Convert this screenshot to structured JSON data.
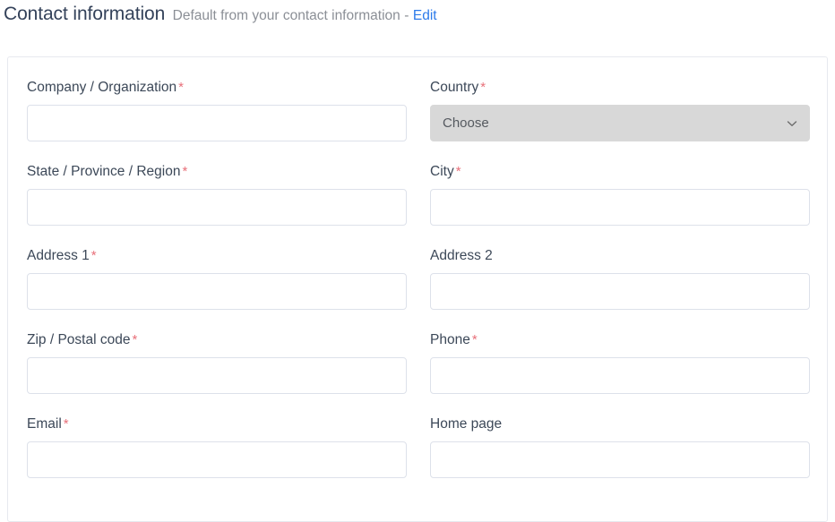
{
  "header": {
    "title": "Contact information",
    "subtitle": "Default from your contact information",
    "separator": "-",
    "edit_label": "Edit"
  },
  "colors": {
    "page_background": "#ffffff",
    "card_border": "#e7e9ef",
    "label_text": "#3c4858",
    "subtitle_text": "#8b8f96",
    "link_blue": "#2d7bea",
    "required_asterisk": "#e8707a",
    "input_border": "#dde1ea",
    "select_background": "#d8d8d8"
  },
  "form": {
    "required_marker": "*",
    "fields": [
      {
        "name": "company",
        "label": "Company / Organization",
        "required": true,
        "type": "text",
        "value": "",
        "placeholder": ""
      },
      {
        "name": "country",
        "label": "Country",
        "required": true,
        "type": "select",
        "value": "Choose",
        "icon": "chevron-down-icon"
      },
      {
        "name": "state",
        "label": "State / Province / Region",
        "required": true,
        "type": "text",
        "value": "",
        "placeholder": ""
      },
      {
        "name": "city",
        "label": "City",
        "required": true,
        "type": "text",
        "value": "",
        "placeholder": ""
      },
      {
        "name": "address1",
        "label": "Address 1",
        "required": true,
        "type": "text",
        "value": "",
        "placeholder": ""
      },
      {
        "name": "address2",
        "label": "Address 2",
        "required": false,
        "type": "text",
        "value": "",
        "placeholder": ""
      },
      {
        "name": "zip",
        "label": "Zip / Postal code",
        "required": true,
        "type": "text",
        "value": "",
        "placeholder": ""
      },
      {
        "name": "phone",
        "label": "Phone",
        "required": true,
        "type": "text",
        "value": "",
        "placeholder": ""
      },
      {
        "name": "email",
        "label": "Email",
        "required": true,
        "type": "text",
        "value": "",
        "placeholder": ""
      },
      {
        "name": "homepage",
        "label": "Home page",
        "required": false,
        "type": "text",
        "value": "",
        "placeholder": ""
      }
    ]
  }
}
